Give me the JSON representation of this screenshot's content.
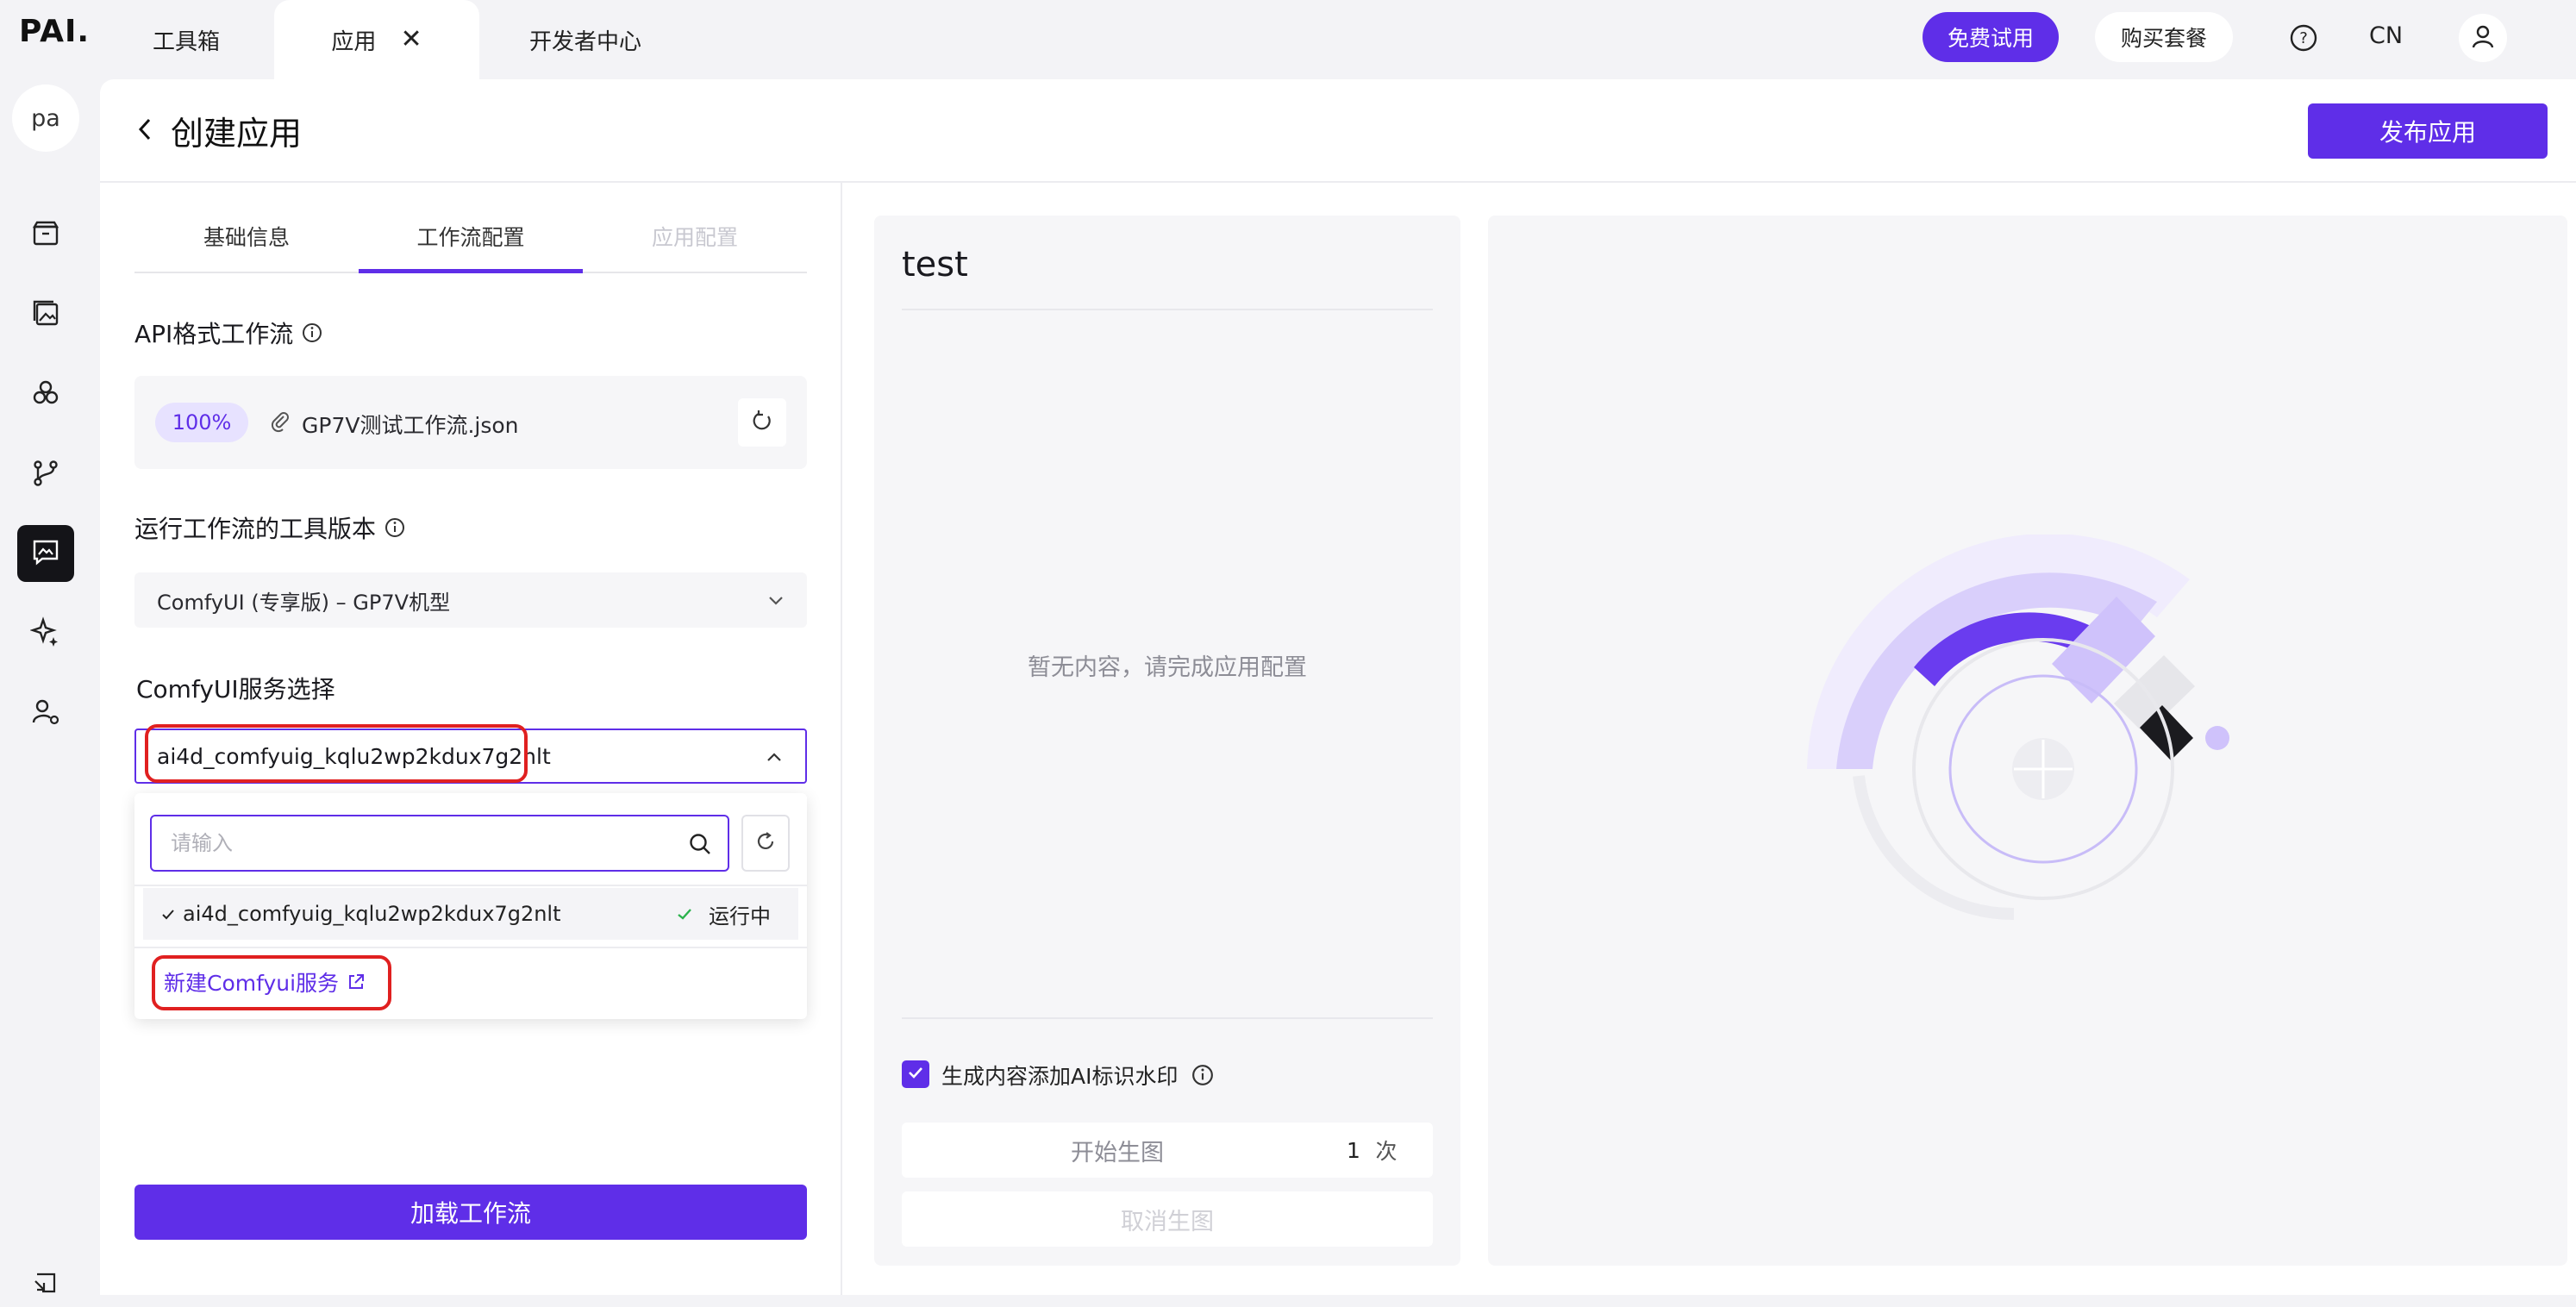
{
  "topbar": {
    "logo": "PAI.",
    "tabs": [
      {
        "label": "工具箱"
      },
      {
        "label": "应用",
        "active": true
      },
      {
        "label": "开发者中心"
      }
    ],
    "free_trial": "免费试用",
    "buy_plan": "购买套餐",
    "lang": "CN"
  },
  "sidebar": {
    "avatar_text": "pa",
    "items": [
      {
        "icon": "box-icon"
      },
      {
        "icon": "gallery-icon"
      },
      {
        "icon": "models-icon"
      },
      {
        "icon": "workflow-icon"
      },
      {
        "icon": "chat-app-icon",
        "active": true
      },
      {
        "icon": "sparkle-icon"
      },
      {
        "icon": "user-settings-icon"
      }
    ],
    "bottom_icon": "collapse-icon"
  },
  "header": {
    "title": "创建应用",
    "publish": "发布应用"
  },
  "config": {
    "subtabs": [
      {
        "label": "基础信息"
      },
      {
        "label": "工作流配置",
        "active": true
      },
      {
        "label": "应用配置",
        "disabled": true
      }
    ],
    "api_workflow_label": "API格式工作流",
    "upload_progress": "100%",
    "file_name": "GP7V测试工作流.json",
    "tool_version_label": "运行工作流的工具版本",
    "tool_version_value": "ComfyUI (专享版) – GP7V机型",
    "service_label": "ComfyUI服务选择",
    "service_value": "ai4d_comfyuig_kqlu2wp2kdux7g2nlt",
    "search_placeholder": "请输入",
    "options": [
      {
        "name": "ai4d_comfyuig_kqlu2wp2kdux7g2nlt",
        "status": "运行中"
      }
    ],
    "new_service_link": "新建Comfyui服务",
    "load_button": "加载工作流"
  },
  "preview": {
    "title": "test",
    "empty": "暂无内容，请完成应用配置",
    "watermark_label": "生成内容添加AI标识水印",
    "watermark_checked": true,
    "start_label": "开始生图",
    "count": "1",
    "count_unit": "次",
    "cancel_label": "取消生图"
  },
  "colors": {
    "accent": "#5f2ee8",
    "highlight_ring": "#e02020",
    "success": "#2bb24c"
  }
}
